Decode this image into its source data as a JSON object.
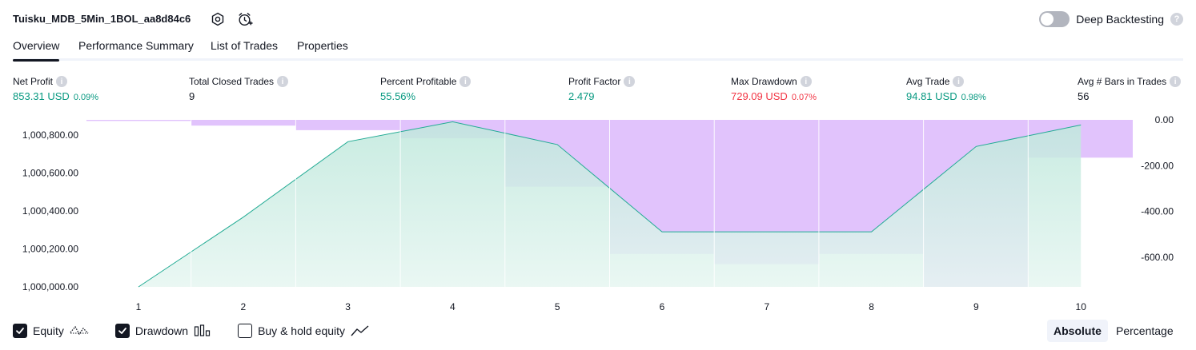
{
  "header": {
    "strategy_name": "Tuisku_MDB_5Min_1BOL_aa8d84c6",
    "deep_backtesting_label": "Deep Backtesting",
    "deep_backtesting_on": false,
    "help_glyph": "?"
  },
  "tabs": [
    {
      "label": "Overview",
      "active": true
    },
    {
      "label": "Performance Summary",
      "active": false
    },
    {
      "label": "List of Trades",
      "active": false
    },
    {
      "label": "Properties",
      "active": false
    }
  ],
  "metrics": [
    {
      "label": "Net Profit",
      "value": "853.31 USD",
      "pct": "0.09%",
      "tone": "green"
    },
    {
      "label": "Total Closed Trades",
      "value": "9",
      "pct": "",
      "tone": "plain"
    },
    {
      "label": "Percent Profitable",
      "value": "55.56%",
      "pct": "",
      "tone": "green"
    },
    {
      "label": "Profit Factor",
      "value": "2.479",
      "pct": "",
      "tone": "green"
    },
    {
      "label": "Max Drawdown",
      "value": "729.09 USD",
      "pct": "0.07%",
      "tone": "red"
    },
    {
      "label": "Avg Trade",
      "value": "94.81 USD",
      "pct": "0.98%",
      "tone": "green"
    },
    {
      "label": "Avg # Bars in Trades",
      "value": "56",
      "pct": "",
      "tone": "plain"
    }
  ],
  "info_glyph": "i",
  "legend": [
    {
      "label": "Equity",
      "checked": true,
      "icon": "equity-line-icon"
    },
    {
      "label": "Drawdown",
      "checked": true,
      "icon": "drawdown-bars-icon"
    },
    {
      "label": "Buy & hold equity",
      "checked": false,
      "icon": "buy-hold-line-icon"
    }
  ],
  "view_modes": [
    {
      "label": "Absolute",
      "active": true
    },
    {
      "label": "Percentage",
      "active": false
    }
  ],
  "chart_data": {
    "type": "area",
    "x": [
      1,
      2,
      3,
      4,
      5,
      6,
      7,
      8,
      9,
      10
    ],
    "x_tick_labels": [
      "1",
      "2",
      "3",
      "4",
      "5",
      "6",
      "7",
      "8",
      "9",
      "10"
    ],
    "series": [
      {
        "axis": "left",
        "style": "area",
        "color": "#22ab94",
        "fill": "#d2f0e8",
        "values": [
          1000000,
          1000367,
          1000765,
          1000870,
          1000750,
          1000290,
          1000290,
          1000290,
          1000740,
          1000853
        ]
      },
      {
        "axis": "right",
        "style": "bars",
        "color": "#e1c3fc",
        "values": [
          -5,
          -25,
          -45,
          -80,
          -292,
          -585,
          -630,
          -585,
          -729,
          -165
        ]
      }
    ],
    "y_left": {
      "ylim": [
        1000000,
        1000880
      ],
      "ticks": [
        1000000,
        1000200,
        1000400,
        1000600,
        1000800
      ],
      "tick_labels": [
        "1,000,000.00",
        "1,000,200.00",
        "1,000,400.00",
        "1,000,600.00",
        "1,000,800.00"
      ]
    },
    "y_right": {
      "ylim": [
        -729,
        0
      ],
      "ticks": [
        0,
        -200,
        -400,
        -600
      ],
      "tick_labels": [
        "0.00",
        "-200.00",
        "-400.00",
        "-600.00"
      ]
    },
    "grid": true,
    "xlabel": "",
    "ylabel": ""
  }
}
